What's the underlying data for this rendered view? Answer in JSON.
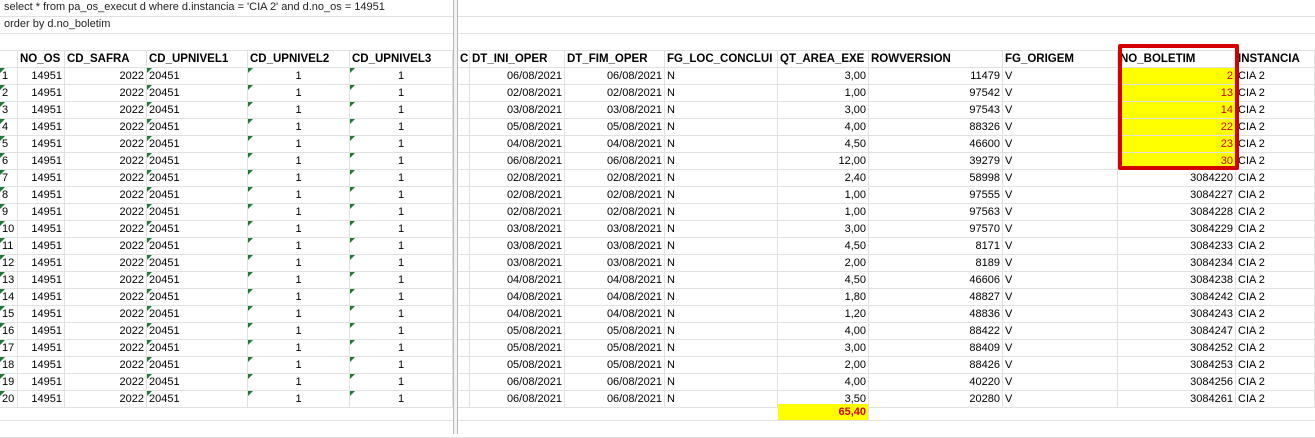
{
  "sql": {
    "line1": "select * from pa_os_execut d where d.instancia = 'CIA 2' and  d.no_os = 14951",
    "line2": "order by d.no_boletim"
  },
  "headers": {
    "no_os": "NO_OS",
    "cd_safra": "CD_SAFRA",
    "cd_upnivel1": "CD_UPNIVEL1",
    "cd_upnivel2": "CD_UPNIVEL2",
    "cd_upnivel3": "CD_UPNIVEL3",
    "c": "C",
    "dt_ini_oper": "DT_INI_OPER",
    "dt_fim_oper": "DT_FIM_OPER",
    "fg_loc_conclui": "FG_LOC_CONCLUI",
    "qt_area_exe": "QT_AREA_EXE",
    "rowversion": "ROWVERSION",
    "fg_origem": "FG_ORIGEM",
    "no_boletim": "NO_BOLETIM",
    "instancia": "INSTANCIA"
  },
  "rows": [
    {
      "n": "1",
      "no_os": "14951",
      "safra": "2022",
      "up1": "20451",
      "up2": "1",
      "up3": "1",
      "ini": "06/08/2021",
      "fim": "06/08/2021",
      "loc": "N",
      "area": "3,00",
      "rowv": "11479",
      "orig": "V",
      "bol": "2",
      "inst": "CIA 2"
    },
    {
      "n": "2",
      "no_os": "14951",
      "safra": "2022",
      "up1": "20451",
      "up2": "1",
      "up3": "1",
      "ini": "02/08/2021",
      "fim": "02/08/2021",
      "loc": "N",
      "area": "1,00",
      "rowv": "97542",
      "orig": "V",
      "bol": "13",
      "inst": "CIA 2"
    },
    {
      "n": "3",
      "no_os": "14951",
      "safra": "2022",
      "up1": "20451",
      "up2": "1",
      "up3": "1",
      "ini": "03/08/2021",
      "fim": "03/08/2021",
      "loc": "N",
      "area": "3,00",
      "rowv": "97543",
      "orig": "V",
      "bol": "14",
      "inst": "CIA 2"
    },
    {
      "n": "4",
      "no_os": "14951",
      "safra": "2022",
      "up1": "20451",
      "up2": "1",
      "up3": "1",
      "ini": "05/08/2021",
      "fim": "05/08/2021",
      "loc": "N",
      "area": "4,00",
      "rowv": "88326",
      "orig": "V",
      "bol": "22",
      "inst": "CIA 2"
    },
    {
      "n": "5",
      "no_os": "14951",
      "safra": "2022",
      "up1": "20451",
      "up2": "1",
      "up3": "1",
      "ini": "04/08/2021",
      "fim": "04/08/2021",
      "loc": "N",
      "area": "4,50",
      "rowv": "46600",
      "orig": "V",
      "bol": "23",
      "inst": "CIA 2"
    },
    {
      "n": "6",
      "no_os": "14951",
      "safra": "2022",
      "up1": "20451",
      "up2": "1",
      "up3": "1",
      "ini": "06/08/2021",
      "fim": "06/08/2021",
      "loc": "N",
      "area": "12,00",
      "rowv": "39279",
      "orig": "V",
      "bol": "30",
      "inst": "CIA 2"
    },
    {
      "n": "7",
      "no_os": "14951",
      "safra": "2022",
      "up1": "20451",
      "up2": "1",
      "up3": "1",
      "ini": "02/08/2021",
      "fim": "02/08/2021",
      "loc": "N",
      "area": "2,40",
      "rowv": "58998",
      "orig": "V",
      "bol": "3084220",
      "inst": "CIA 2"
    },
    {
      "n": "8",
      "no_os": "14951",
      "safra": "2022",
      "up1": "20451",
      "up2": "1",
      "up3": "1",
      "ini": "02/08/2021",
      "fim": "02/08/2021",
      "loc": "N",
      "area": "1,00",
      "rowv": "97555",
      "orig": "V",
      "bol": "3084227",
      "inst": "CIA 2"
    },
    {
      "n": "9",
      "no_os": "14951",
      "safra": "2022",
      "up1": "20451",
      "up2": "1",
      "up3": "1",
      "ini": "02/08/2021",
      "fim": "02/08/2021",
      "loc": "N",
      "area": "1,00",
      "rowv": "97563",
      "orig": "V",
      "bol": "3084228",
      "inst": "CIA 2"
    },
    {
      "n": "10",
      "no_os": "14951",
      "safra": "2022",
      "up1": "20451",
      "up2": "1",
      "up3": "1",
      "ini": "03/08/2021",
      "fim": "03/08/2021",
      "loc": "N",
      "area": "3,00",
      "rowv": "97570",
      "orig": "V",
      "bol": "3084229",
      "inst": "CIA 2"
    },
    {
      "n": "11",
      "no_os": "14951",
      "safra": "2022",
      "up1": "20451",
      "up2": "1",
      "up3": "1",
      "ini": "03/08/2021",
      "fim": "03/08/2021",
      "loc": "N",
      "area": "4,50",
      "rowv": "8171",
      "orig": "V",
      "bol": "3084233",
      "inst": "CIA 2"
    },
    {
      "n": "12",
      "no_os": "14951",
      "safra": "2022",
      "up1": "20451",
      "up2": "1",
      "up3": "1",
      "ini": "03/08/2021",
      "fim": "03/08/2021",
      "loc": "N",
      "area": "2,00",
      "rowv": "8189",
      "orig": "V",
      "bol": "3084234",
      "inst": "CIA 2"
    },
    {
      "n": "13",
      "no_os": "14951",
      "safra": "2022",
      "up1": "20451",
      "up2": "1",
      "up3": "1",
      "ini": "04/08/2021",
      "fim": "04/08/2021",
      "loc": "N",
      "area": "4,50",
      "rowv": "46606",
      "orig": "V",
      "bol": "3084238",
      "inst": "CIA 2"
    },
    {
      "n": "14",
      "no_os": "14951",
      "safra": "2022",
      "up1": "20451",
      "up2": "1",
      "up3": "1",
      "ini": "04/08/2021",
      "fim": "04/08/2021",
      "loc": "N",
      "area": "1,80",
      "rowv": "48827",
      "orig": "V",
      "bol": "3084242",
      "inst": "CIA 2"
    },
    {
      "n": "15",
      "no_os": "14951",
      "safra": "2022",
      "up1": "20451",
      "up2": "1",
      "up3": "1",
      "ini": "04/08/2021",
      "fim": "04/08/2021",
      "loc": "N",
      "area": "1,20",
      "rowv": "48836",
      "orig": "V",
      "bol": "3084243",
      "inst": "CIA 2"
    },
    {
      "n": "16",
      "no_os": "14951",
      "safra": "2022",
      "up1": "20451",
      "up2": "1",
      "up3": "1",
      "ini": "05/08/2021",
      "fim": "05/08/2021",
      "loc": "N",
      "area": "4,00",
      "rowv": "88422",
      "orig": "V",
      "bol": "3084247",
      "inst": "CIA 2"
    },
    {
      "n": "17",
      "no_os": "14951",
      "safra": "2022",
      "up1": "20451",
      "up2": "1",
      "up3": "1",
      "ini": "05/08/2021",
      "fim": "05/08/2021",
      "loc": "N",
      "area": "3,00",
      "rowv": "88409",
      "orig": "V",
      "bol": "3084252",
      "inst": "CIA 2"
    },
    {
      "n": "18",
      "no_os": "14951",
      "safra": "2022",
      "up1": "20451",
      "up2": "1",
      "up3": "1",
      "ini": "05/08/2021",
      "fim": "05/08/2021",
      "loc": "N",
      "area": "2,00",
      "rowv": "88426",
      "orig": "V",
      "bol": "3084253",
      "inst": "CIA 2"
    },
    {
      "n": "19",
      "no_os": "14951",
      "safra": "2022",
      "up1": "20451",
      "up2": "1",
      "up3": "1",
      "ini": "06/08/2021",
      "fim": "06/08/2021",
      "loc": "N",
      "area": "4,00",
      "rowv": "40220",
      "orig": "V",
      "bol": "3084256",
      "inst": "CIA 2"
    },
    {
      "n": "20",
      "no_os": "14951",
      "safra": "2022",
      "up1": "20451",
      "up2": "1",
      "up3": "1",
      "ini": "06/08/2021",
      "fim": "06/08/2021",
      "loc": "N",
      "area": "3,50",
      "rowv": "20280",
      "orig": "V",
      "bol": "3084261",
      "inst": "CIA 2"
    }
  ],
  "total": {
    "area_sum": "65,40"
  },
  "colors": {
    "highlight_fill": "#ffff00",
    "highlight_border": "#d40000",
    "error_indicator": "#1e7b34"
  }
}
